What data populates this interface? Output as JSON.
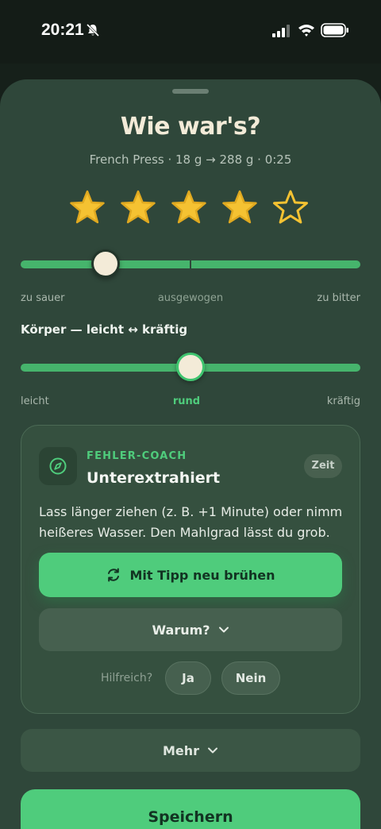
{
  "status_bar": {
    "time": "20:21"
  },
  "sheet": {
    "title": "Wie war's?",
    "subtitle": "French Press · 18 g → 288 g · 0:25",
    "rating": {
      "value": 4,
      "max": 5
    }
  },
  "taste_slider": {
    "value": 0.25,
    "left_label": "zu sauer",
    "mid_label": "ausgewogen",
    "right_label": "zu bitter"
  },
  "body_slider": {
    "section_label": "Körper — leicht ↔ kräftig",
    "value": 0.5,
    "left_label": "leicht",
    "mid_label": "rund",
    "right_label": "kräftig"
  },
  "coach": {
    "overline": "FEHLER-COACH",
    "title": "Unterextrahiert",
    "chip": "Zeit",
    "text": "Lass länger ziehen (z. B. +1 Minute) oder nimm heißeres Wasser. Den Mahlgrad lässt du grob.",
    "primary_label": "Mit Tipp neu brühen",
    "why_label": "Warum?",
    "helpful_label": "Hilfreich?",
    "yes_label": "Ja",
    "no_label": "Nein"
  },
  "more_label": "Mehr",
  "save_label": "Speichern",
  "colors": {
    "accent": "#4fcc7c",
    "star": "#f5c232",
    "sheet_bg": "#2f473a",
    "title": "#f3ebd8"
  },
  "icons": {
    "status": [
      "bell-slash-icon",
      "signal-icon",
      "wifi-icon",
      "battery-icon"
    ],
    "coach": "compass-icon",
    "primary": "refresh-icon",
    "chevron": "chevron-down-icon"
  }
}
